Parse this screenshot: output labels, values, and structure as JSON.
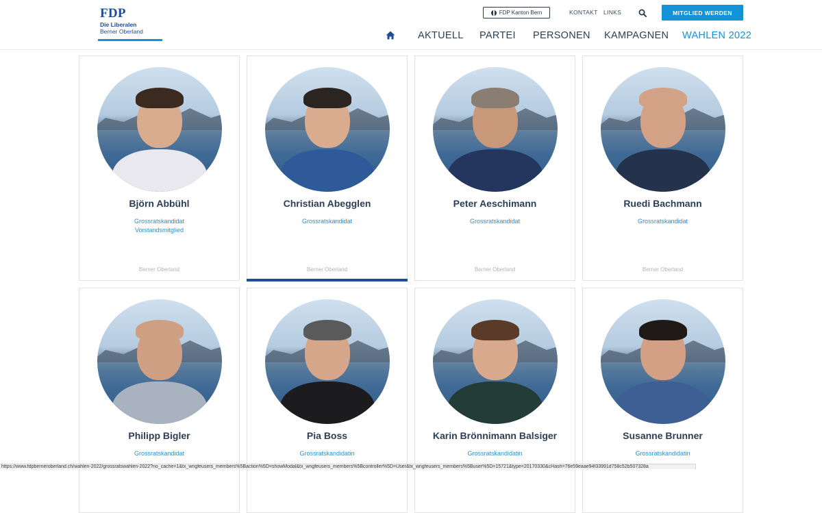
{
  "brand": {
    "logo_title": "FDP",
    "logo_line1": "Die Liberalen",
    "logo_line2": "Berner Oberland"
  },
  "topbar": {
    "kanton_label": "FDP Kanton Bern",
    "links": [
      "KONTAKT",
      "LINKS"
    ],
    "cta_label": "MITGLIED WERDEN"
  },
  "nav": {
    "items": [
      "AKTUELL",
      "PARTEI",
      "PERSONEN",
      "KAMPAGNEN",
      "WAHLEN 2022"
    ],
    "active": "WAHLEN 2022"
  },
  "cards": [
    {
      "name": "Björn Abbühl",
      "roles": [
        "Grossratskandidat",
        "Vorstandsmitglied"
      ],
      "region": "Berner Oberland"
    },
    {
      "name": "Christian Abegglen",
      "roles": [
        "Grossratskandidat"
      ],
      "region": "Berner Oberland"
    },
    {
      "name": "Peter Aeschimann",
      "roles": [
        "Grossratskandidat"
      ],
      "region": "Berner Oberland"
    },
    {
      "name": "Ruedi Bachmann",
      "roles": [
        "Grossratskandidat"
      ],
      "region": "Berner Oberland"
    },
    {
      "name": "Philipp Bigler",
      "roles": [
        "Grossratskandidat"
      ],
      "region": ""
    },
    {
      "name": "Pia Boss",
      "roles": [
        "Grossratskandidatin"
      ],
      "region": ""
    },
    {
      "name": "Karin Brönnimann Balsiger",
      "roles": [
        "Grossratskandidatin"
      ],
      "region": ""
    },
    {
      "name": "Susanne Brunner",
      "roles": [
        "Grossratskandidatin"
      ],
      "region": ""
    }
  ],
  "status_url": "https://www.fdpberneroberland.ch/wahlen-2022/grossratswahlen-2022?no_cache=1&tx_wngfeusers_members%5Baction%5D=showModal&tx_wngfeusers_members%5Bcontroller%5D=User&tx_wngfeusers_members%5Buser%5D=15721&type=20170330&cHash=76e59eaae94f33991d758c52b507328a",
  "colors": {
    "brand_blue": "#1b4e97",
    "accent": "#1392d8",
    "text_dark": "#2c3e57"
  }
}
